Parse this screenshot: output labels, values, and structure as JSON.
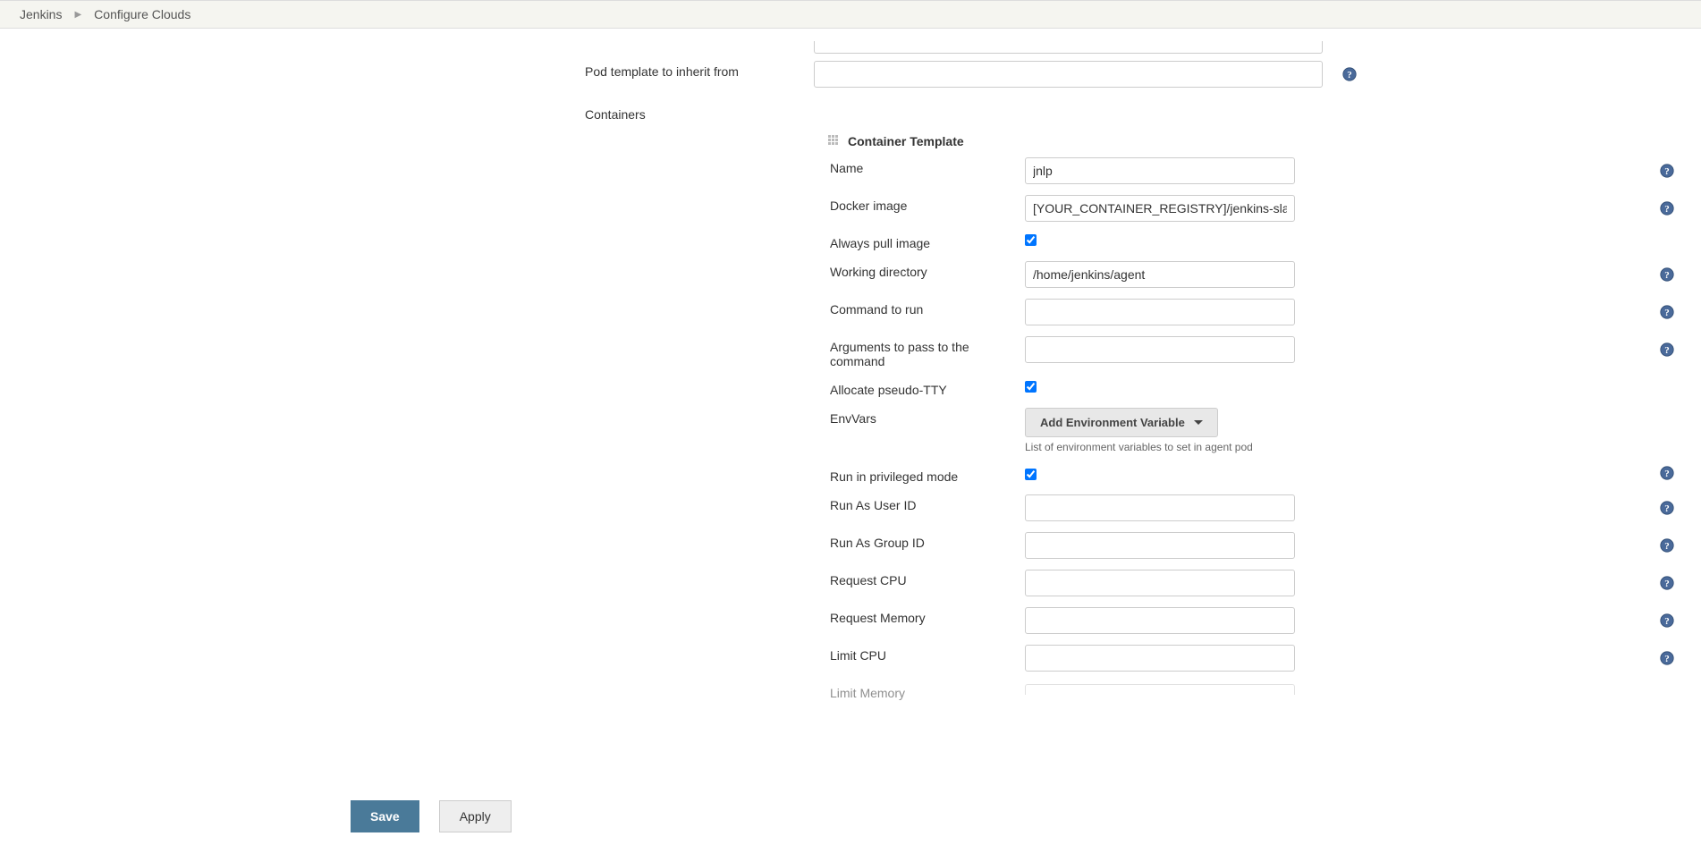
{
  "breadcrumb": {
    "root": "Jenkins",
    "page": "Configure Clouds"
  },
  "form": {
    "pod_template_inherit_label": "Pod template to inherit from",
    "pod_template_inherit_value": "",
    "containers_label": "Containers",
    "container_template_title": "Container Template",
    "fields": {
      "name_label": "Name",
      "name_value": "jnlp",
      "docker_label": "Docker image",
      "docker_value": "[YOUR_CONTAINER_REGISTRY]/jenkins-slave",
      "always_pull_label": "Always pull image",
      "always_pull_checked": true,
      "workdir_label": "Working directory",
      "workdir_value": "/home/jenkins/agent",
      "command_label": "Command to run",
      "command_value": "",
      "args_label": "Arguments to pass to the command",
      "args_value": "",
      "tty_label": "Allocate pseudo-TTY",
      "tty_checked": true,
      "envvars_label": "EnvVars",
      "envvars_btn": "Add Environment Variable",
      "envvars_hint": "List of environment variables to set in agent pod",
      "privileged_label": "Run in privileged mode",
      "privileged_checked": true,
      "run_uid_label": "Run As User ID",
      "run_uid_value": "",
      "run_gid_label": "Run As Group ID",
      "run_gid_value": "",
      "req_cpu_label": "Request CPU",
      "req_cpu_value": "",
      "req_mem_label": "Request Memory",
      "req_mem_value": "",
      "limit_cpu_label": "Limit CPU",
      "limit_cpu_value": "",
      "limit_mem_label": "Limit Memory"
    }
  },
  "footer": {
    "save": "Save",
    "apply": "Apply"
  }
}
